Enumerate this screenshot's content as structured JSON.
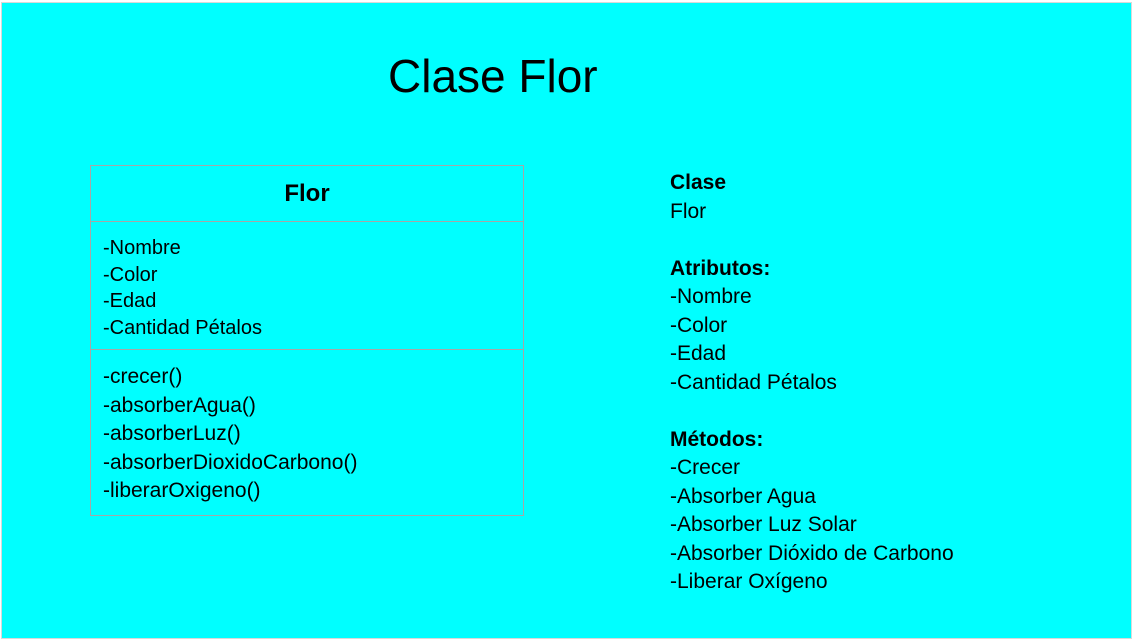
{
  "title": "Clase Flor",
  "uml": {
    "class_name": "Flor",
    "attributes": [
      "-Nombre",
      "-Color",
      "-Edad",
      "-Cantidad Pétalos"
    ],
    "methods": [
      "-crecer()",
      "-absorberAgua()",
      "-absorberLuz()",
      "-absorberDioxidoCarbono()",
      "-liberarOxigeno()"
    ]
  },
  "description": {
    "clase_heading": "Clase",
    "clase_value": "Flor",
    "atributos_heading": "Atributos:",
    "atributos": [
      "-Nombre",
      "-Color",
      "-Edad",
      "-Cantidad Pétalos"
    ],
    "metodos_heading": "Métodos:",
    "metodos": [
      "-Crecer",
      "-Absorber Agua",
      "-Absorber Luz Solar",
      "-Absorber Dióxido de Carbono",
      "-Liberar Oxígeno"
    ]
  },
  "colors": {
    "background": "#00ffff",
    "border": "#a6a6a6"
  }
}
